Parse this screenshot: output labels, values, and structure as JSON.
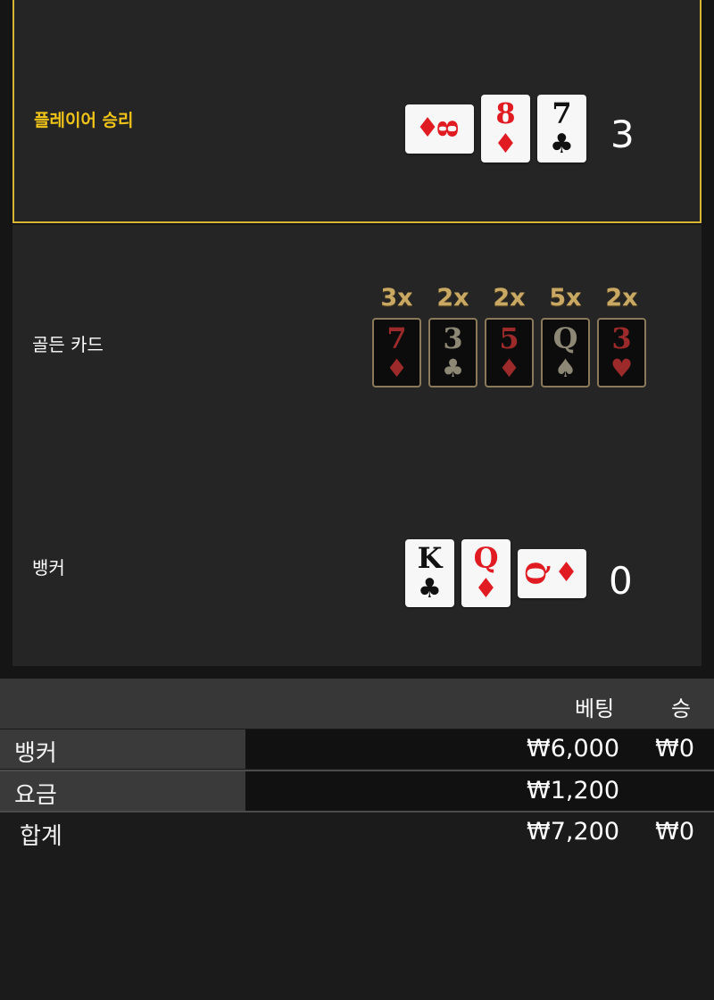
{
  "player": {
    "label": "플레이어 승리",
    "score": "3",
    "cards": [
      {
        "rank": "8",
        "suit": "♦",
        "color": "red",
        "orientation": "side"
      },
      {
        "rank": "8",
        "suit": "♦",
        "color": "red",
        "orientation": "up"
      },
      {
        "rank": "7",
        "suit": "♣",
        "color": "black",
        "orientation": "up"
      }
    ]
  },
  "golden": {
    "label": "골든 카드",
    "cards": [
      {
        "mult": "3x",
        "rank": "7",
        "suit": "♦",
        "color": "red"
      },
      {
        "mult": "2x",
        "rank": "3",
        "suit": "♣",
        "color": "gray"
      },
      {
        "mult": "2x",
        "rank": "5",
        "suit": "♦",
        "color": "red"
      },
      {
        "mult": "5x",
        "rank": "Q",
        "suit": "♠",
        "color": "gray"
      },
      {
        "mult": "2x",
        "rank": "3",
        "suit": "♥",
        "color": "red"
      }
    ]
  },
  "banker": {
    "label": "뱅커",
    "score": "0",
    "cards": [
      {
        "rank": "K",
        "suit": "♣",
        "color": "black",
        "orientation": "up"
      },
      {
        "rank": "Q",
        "suit": "♦",
        "color": "red",
        "orientation": "up"
      },
      {
        "rank": "Q",
        "suit": "♦",
        "color": "red",
        "orientation": "side"
      }
    ]
  },
  "summary": {
    "header_bet": "베팅",
    "header_win": "승",
    "rows": [
      {
        "label": "뱅커",
        "bet": "₩6,000",
        "win": "₩0"
      },
      {
        "label": "요금",
        "bet": "₩1,200",
        "win": ""
      }
    ],
    "total": {
      "label": "합계",
      "bet": "₩7,200",
      "win": "₩0"
    }
  },
  "colors": {
    "accent_gold": "#d5b531",
    "win_text": "#f0c419",
    "card_red": "#e01b22",
    "golden_border": "#8a7a5a"
  }
}
